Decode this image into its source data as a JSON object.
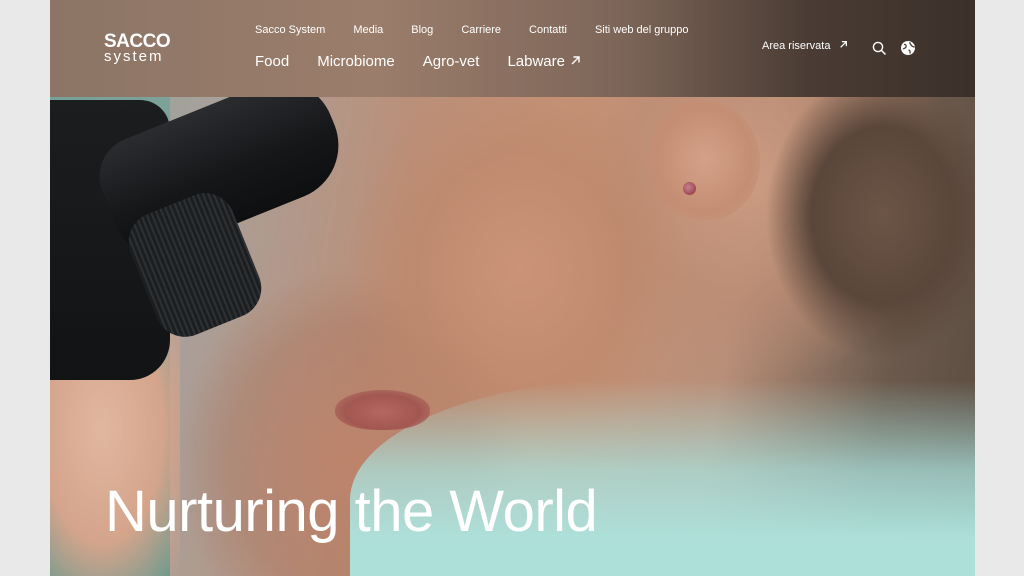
{
  "logo": {
    "line1": "SACCO",
    "line2": "system"
  },
  "top_nav": [
    "Sacco System",
    "Media",
    "Blog",
    "Carriere",
    "Contatti",
    "Siti web del gruppo"
  ],
  "main_nav": [
    {
      "label": "Food"
    },
    {
      "label": "Microbiome"
    },
    {
      "label": "Agro-vet"
    },
    {
      "label": "Labware",
      "icon": "external-arrow-icon"
    }
  ],
  "reserved_area": {
    "label": "Area riservata",
    "icon": "external-arrow-icon"
  },
  "icons": {
    "search": "search-icon",
    "language": "globe-icon"
  },
  "hero": {
    "headline": "Nurturing the World"
  },
  "colors": {
    "text": "#ffffff",
    "header_start": "#8c7566",
    "header_end": "#3b302a"
  }
}
